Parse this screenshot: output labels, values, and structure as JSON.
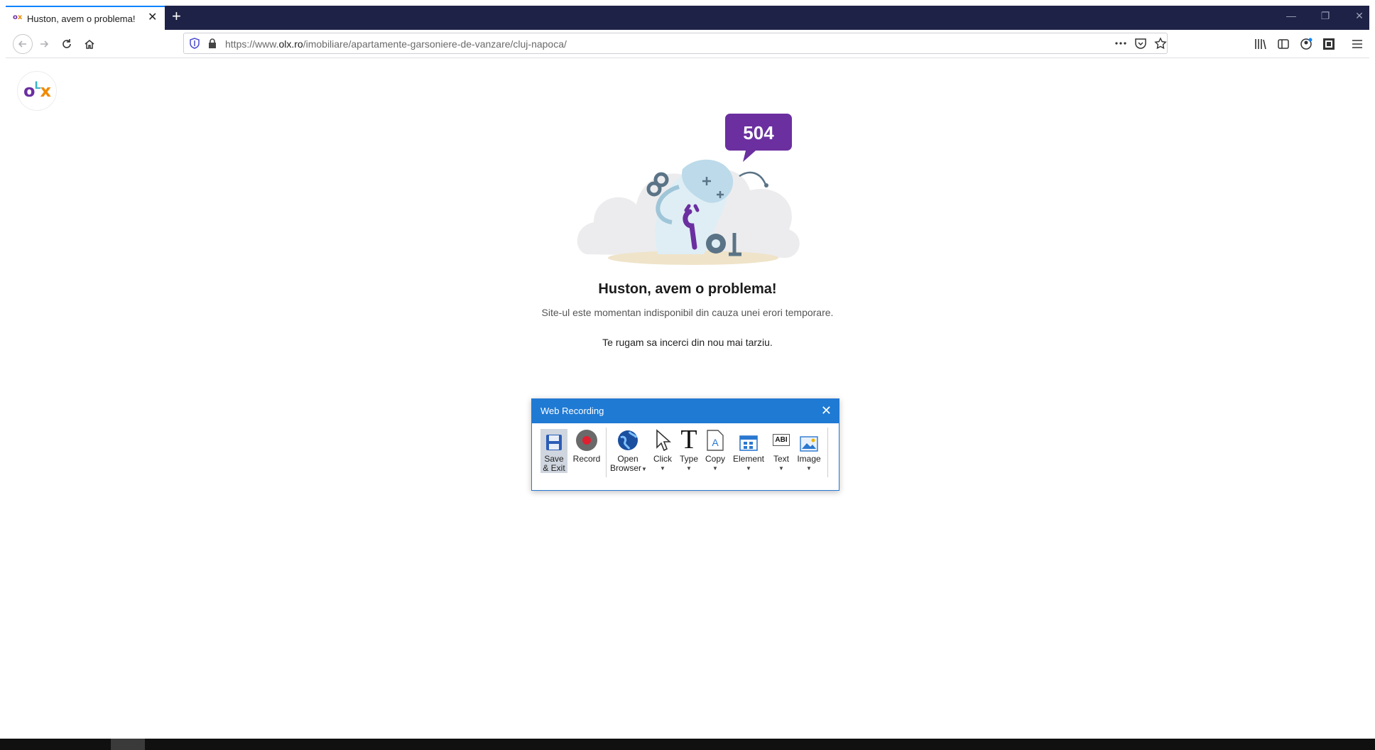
{
  "browser": {
    "tab": {
      "title": "Huston, avem o problema!",
      "favicon_o": "o",
      "favicon_x": "x"
    },
    "new_tab_label": "+",
    "url": {
      "prefix": "https://www.",
      "domain": "olx.ro",
      "path": "/imobiliare/apartamente-garsoniere-de-vanzare/cluj-napoca/"
    },
    "window_controls": {
      "minimize": "—",
      "restore": "❐",
      "close": "✕"
    }
  },
  "page": {
    "logo": {
      "o": "o",
      "l": "L",
      "x": "x"
    },
    "error_code": "504",
    "title": "Huston, avem o problema!",
    "subtitle": "Site-ul este momentan indisponibil din cauza unei erori temporare.",
    "retry": "Te rugam sa incerci din nou mai tarziu."
  },
  "web_recording": {
    "title": "Web Recording",
    "close": "✕",
    "tools": {
      "save": "Save",
      "save_line2": "& Exit",
      "record": "Record",
      "open": "Open",
      "open_line2": "Browser",
      "click": "Click",
      "type": "Type",
      "copy": "Copy",
      "element": "Element",
      "text": "Text",
      "image": "Image",
      "text_icon_label": "ABI",
      "type_icon_label": "T",
      "copy_icon_label": "A"
    }
  },
  "colors": {
    "olx_purple": "#6b2fa0",
    "olx_orange": "#f08a00",
    "titlebar_blue": "#1f7ad4",
    "tab_strip": "#1e2246"
  }
}
